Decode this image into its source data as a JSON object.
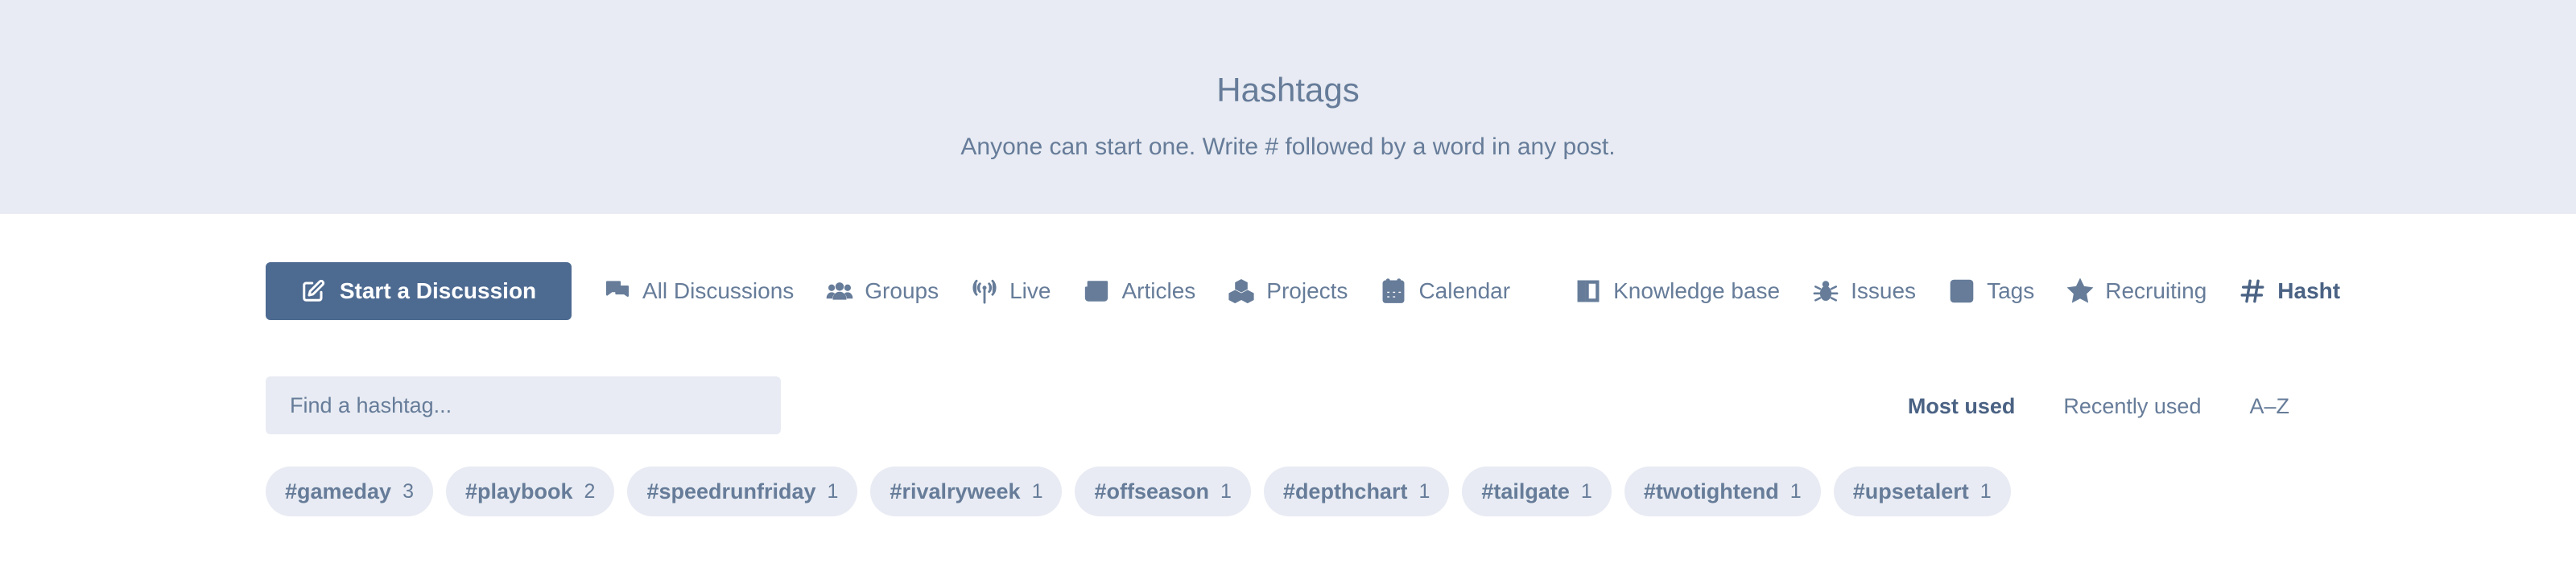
{
  "hero": {
    "title": "Hashtags",
    "subtitle": "Anyone can start one. Write # followed by a word in any post."
  },
  "nav": {
    "start_label": "Start a Discussion",
    "items": [
      {
        "label": "All Discussions",
        "icon": "chat-icon"
      },
      {
        "label": "Groups",
        "icon": "users-icon"
      },
      {
        "label": "Live",
        "icon": "broadcast-icon"
      },
      {
        "label": "Articles",
        "icon": "newspaper-icon"
      },
      {
        "label": "Projects",
        "icon": "cubes-icon"
      },
      {
        "label": "Calendar",
        "icon": "calendar-icon"
      },
      {
        "label": "Knowledge base",
        "icon": "book-icon"
      },
      {
        "label": "Issues",
        "icon": "bug-icon"
      },
      {
        "label": "Tags",
        "icon": "grid-icon"
      },
      {
        "label": "Recruiting",
        "icon": "star-icon"
      },
      {
        "label": "Hasht",
        "icon": "hash-icon"
      }
    ]
  },
  "search": {
    "placeholder": "Find a hashtag..."
  },
  "sort": {
    "options": [
      "Most used",
      "Recently used",
      "A–Z"
    ],
    "active": "Most used"
  },
  "tags": [
    {
      "name": "#gameday",
      "count": "3"
    },
    {
      "name": "#playbook",
      "count": "2"
    },
    {
      "name": "#speedrunfriday",
      "count": "1"
    },
    {
      "name": "#rivalryweek",
      "count": "1"
    },
    {
      "name": "#offseason",
      "count": "1"
    },
    {
      "name": "#depthchart",
      "count": "1"
    },
    {
      "name": "#tailgate",
      "count": "1"
    },
    {
      "name": "#twotightend",
      "count": "1"
    },
    {
      "name": "#upsetalert",
      "count": "1"
    }
  ],
  "colors": {
    "accent": "#4d6a91",
    "hero_bg": "#e8ebf3",
    "text": "#667c99"
  }
}
